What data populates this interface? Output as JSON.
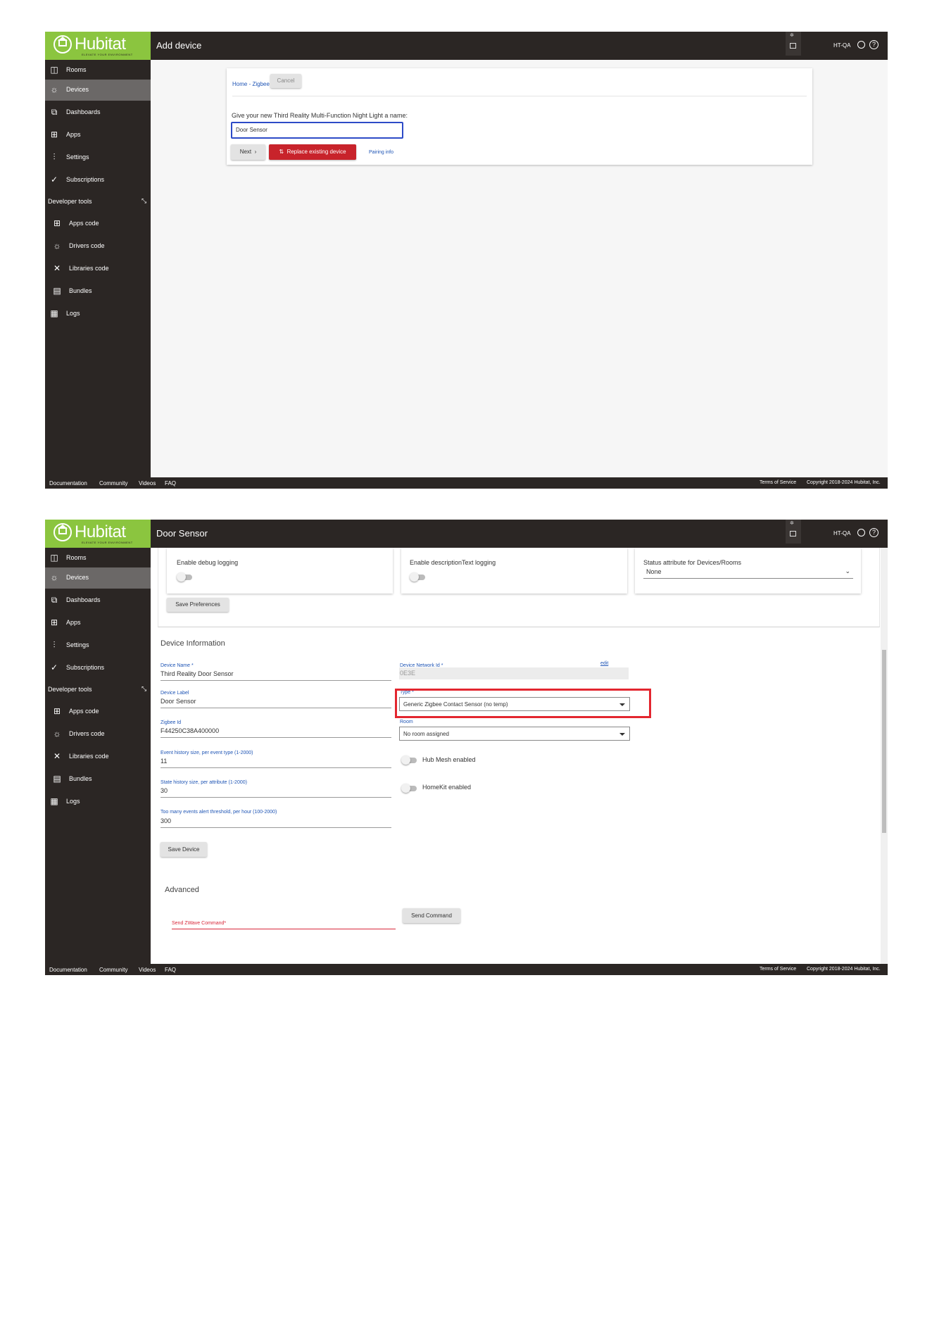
{
  "app": {
    "brand": "Hubitat",
    "brand_tagline": "ELEVATE YOUR ENVIRONMENT",
    "hub_name": "HT-QA",
    "accent_color": "#8bc53f",
    "danger_color": "#c8232b",
    "highlight_color": "#e3262f"
  },
  "sidebar": {
    "items": [
      {
        "label": "Rooms",
        "icon": "rooms-icon"
      },
      {
        "label": "Devices",
        "icon": "bulb-icon"
      },
      {
        "label": "Dashboards",
        "icon": "dashboards-icon"
      },
      {
        "label": "Apps",
        "icon": "apps-icon"
      },
      {
        "label": "Settings",
        "icon": "sliders-icon"
      },
      {
        "label": "Subscriptions",
        "icon": "check-circle-icon"
      }
    ],
    "dev_tools_label": "Developer tools",
    "dev_items": [
      {
        "label": "Apps code",
        "icon": "apps-code-icon"
      },
      {
        "label": "Drivers code",
        "icon": "bulb-icon"
      },
      {
        "label": "Libraries code",
        "icon": "tools-icon"
      },
      {
        "label": "Bundles",
        "icon": "bundle-icon"
      },
      {
        "label": "Logs",
        "icon": "logs-icon"
      }
    ]
  },
  "footer": {
    "links": [
      "Documentation",
      "Community",
      "Videos",
      "FAQ"
    ],
    "terms": "Terms of Service",
    "copyright": "Copyright 2018-2024 Hubitat, Inc."
  },
  "screen1": {
    "title": "Add device",
    "breadcrumb": "Home - Zigbee",
    "cancel_label": "Cancel",
    "prompt": "Give your new Third Reality Multi-Function Night Light a name:",
    "name_value": "Door Sensor",
    "next_label": "Next",
    "replace_label": "Replace existing device",
    "pairing_info_label": "Pairing info"
  },
  "screen2": {
    "title": "Door Sensor",
    "prefs": {
      "debug_label": "Enable debug logging",
      "desc_label": "Enable descriptionText logging",
      "status_attr_label": "Status attribute for Devices/Rooms",
      "status_attr_value": "None",
      "save_prefs_label": "Save Preferences"
    },
    "device_info": {
      "section_title": "Device Information",
      "device_name_label": "Device Name *",
      "device_name_value": "Third Reality Door Sensor",
      "network_id_label": "Device Network Id *",
      "network_id_value": "0E3E",
      "edit_label": "edit",
      "device_label_label": "Device Label",
      "device_label_value": "Door Sensor",
      "type_label": "Type *",
      "type_value": "Generic Zigbee Contact Sensor (no temp)",
      "zigbee_id_label": "Zigbee Id",
      "zigbee_id_value": "F44250C38A400000",
      "room_label": "Room",
      "room_value": "No room assigned",
      "event_history_label": "Event history size, per event type (1-2000)",
      "event_history_value": "11",
      "hub_mesh_label": "Hub Mesh enabled",
      "state_history_label": "State history size, per attribute (1-2000)",
      "state_history_value": "30",
      "homekit_label": "HomeKit enabled",
      "too_many_label": "Too many events alert threshold, per hour (100-2000)",
      "too_many_value": "300",
      "save_device_label": "Save Device"
    },
    "advanced": {
      "section_title": "Advanced",
      "zwave_label": "Send ZWave Command*",
      "send_command_label": "Send Command"
    }
  }
}
